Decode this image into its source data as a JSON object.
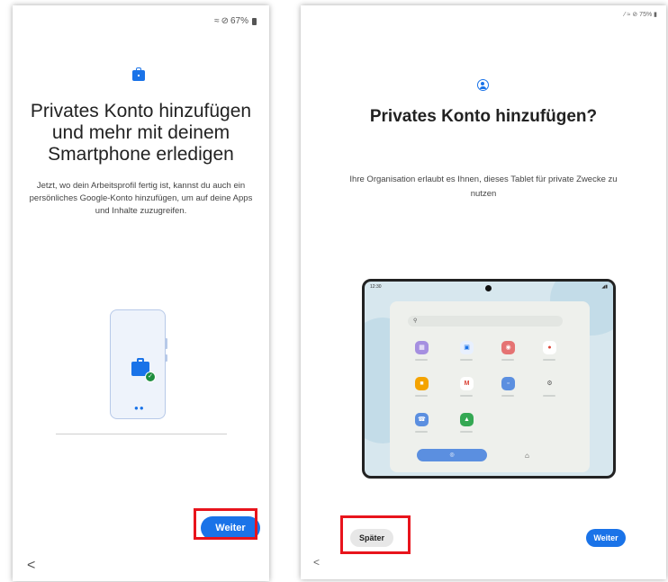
{
  "left": {
    "status": {
      "battery": "67%",
      "wifi_icon": "wifi-icon",
      "dnd_icon": "do-not-disturb-icon"
    },
    "icon": "briefcase-icon",
    "title": "Privates Konto hinzufügen und mehr mit deinem Smartphone erledigen",
    "description": "Jetzt, wo dein Arbeitsprofil fertig ist, kannst du auch ein persönliches Google-Konto hinzufügen, um auf deine Apps und Inhalte zuzugreifen.",
    "next_label": "Weiter",
    "back_icon": "<"
  },
  "right": {
    "status": {
      "battery": "75%"
    },
    "icon": "account-circle-icon",
    "title": "Privates Konto hinzufügen?",
    "description": "Ihre Organisation erlaubt es Ihnen, dieses Tablet für private Zwecke zu nutzen",
    "tablet_clock": "12:30",
    "later_label": "Später",
    "next_label": "Weiter",
    "back_icon": "<"
  },
  "colors": {
    "accent": "#1a73e8",
    "highlight": "#e8141c",
    "success": "#1e8e3e"
  }
}
